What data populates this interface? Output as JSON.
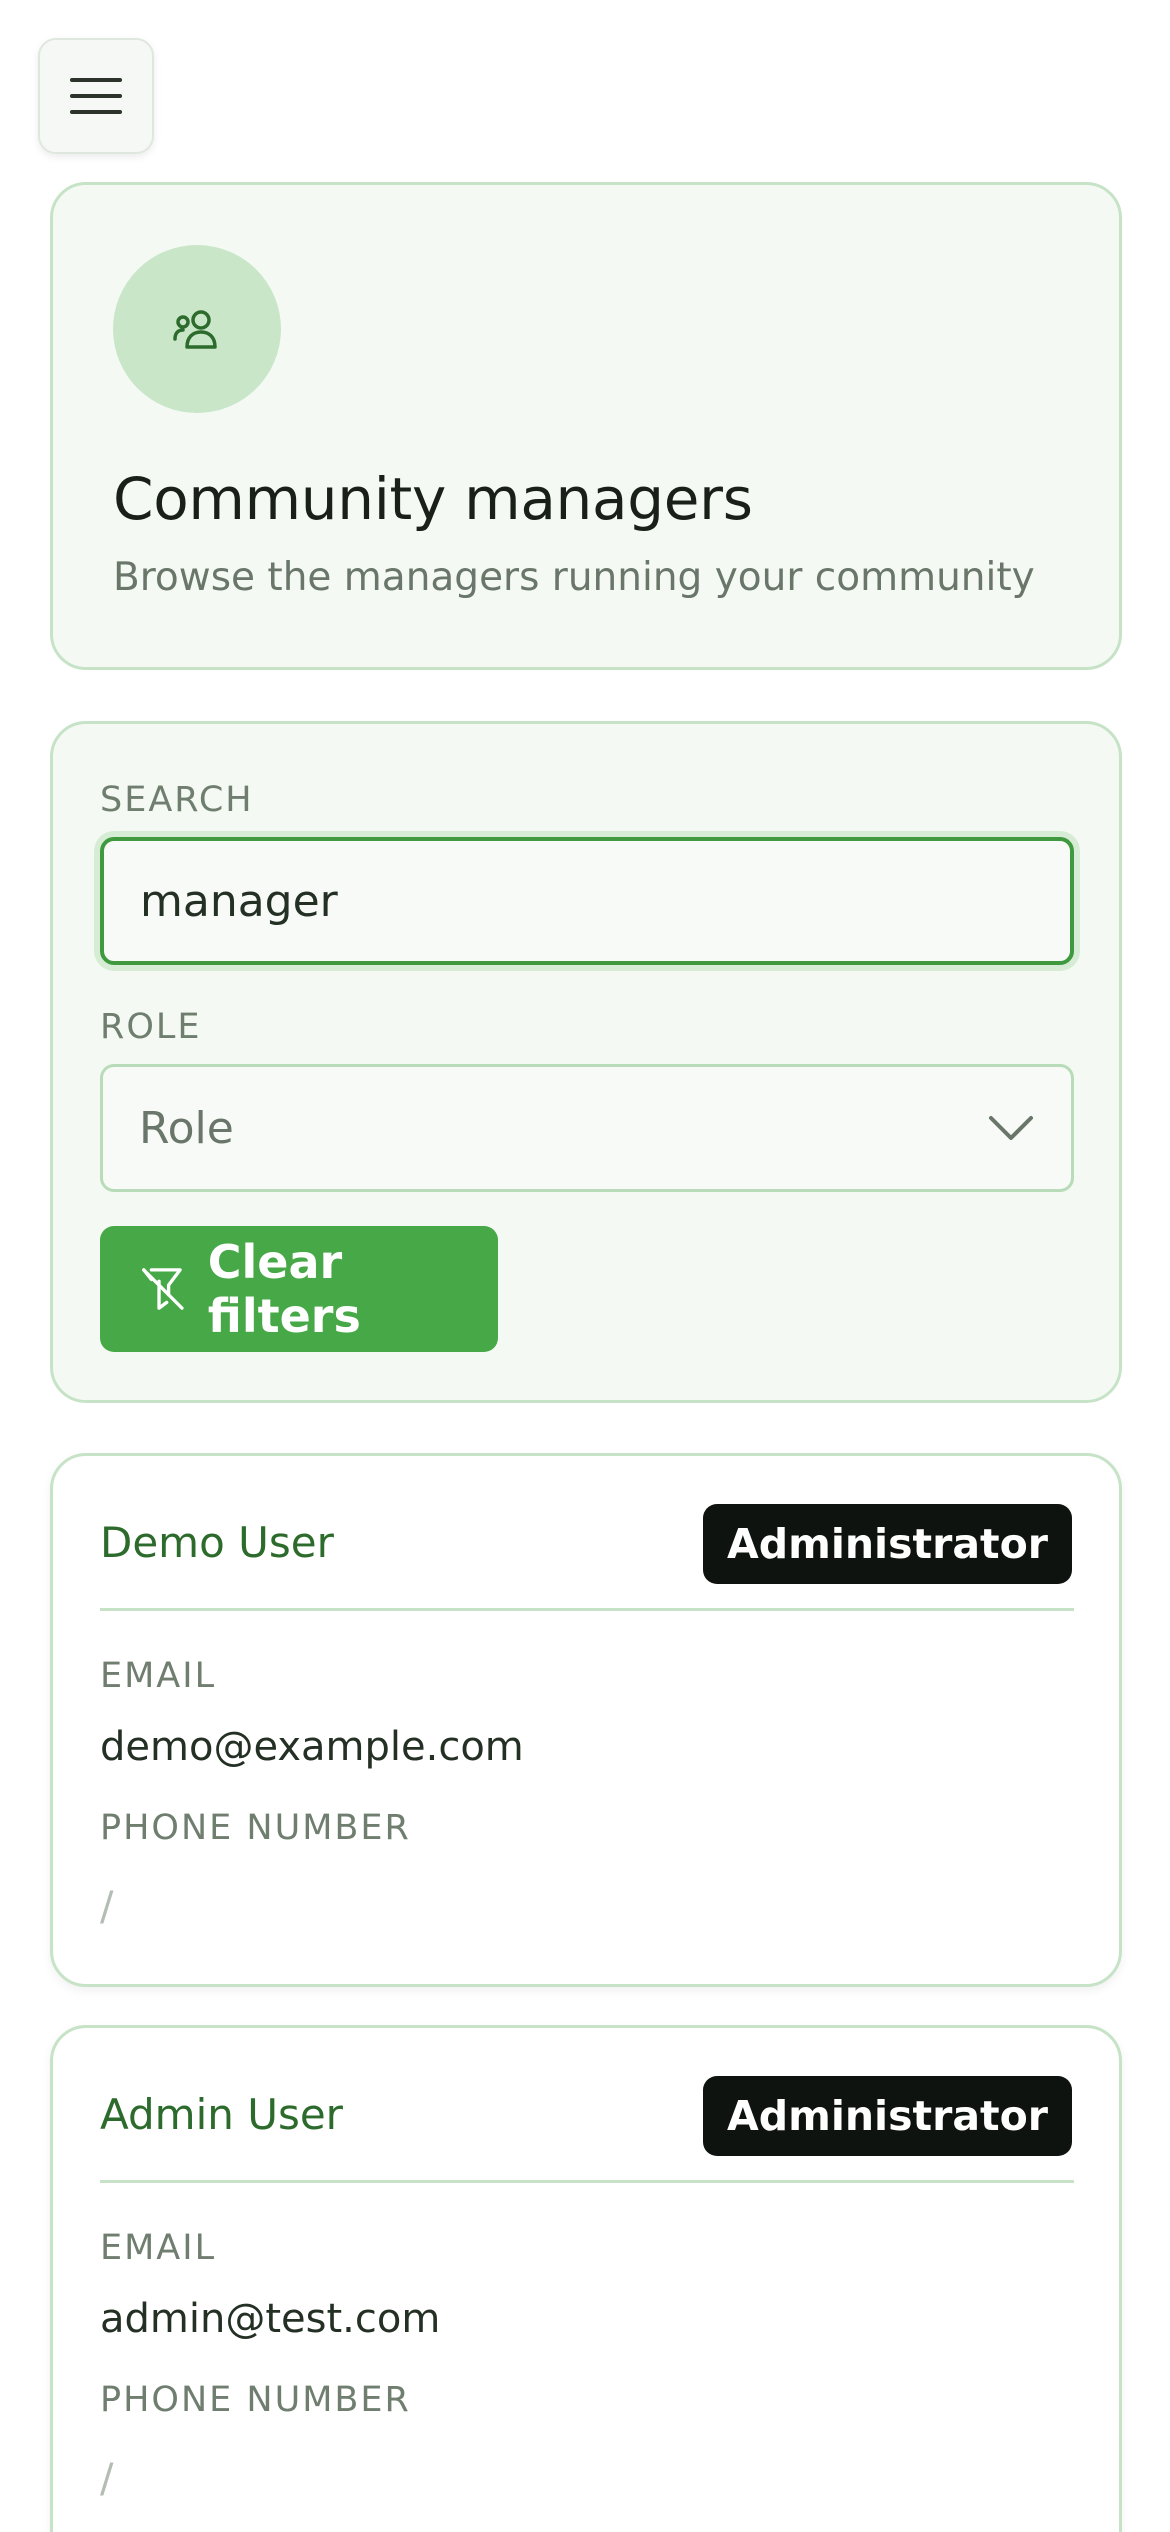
{
  "icons": {
    "menu": "menu-icon",
    "community": "users-icon",
    "chevron": "chevron-down-icon",
    "filter_off": "filter-off-icon"
  },
  "header": {
    "title": "Community managers",
    "subtitle": "Browse the managers running your community"
  },
  "filters": {
    "search_label": "SEARCH",
    "search_value": "manager",
    "role_label": "ROLE",
    "role_value": "Role",
    "clear_label": "Clear filters"
  },
  "users": [
    {
      "name": "Demo User",
      "role": "Administrator",
      "email_label": "EMAIL",
      "email": "demo@example.com",
      "phone_label": "PHONE NUMBER",
      "phone": "/"
    },
    {
      "name": "Admin User",
      "role": "Administrator",
      "email_label": "EMAIL",
      "email": "admin@test.com",
      "phone_label": "PHONE NUMBER",
      "phone": "/"
    }
  ],
  "colors": {
    "accent": "#46a846",
    "card_border": "#c7e3c7",
    "card_bg": "#f4faf3",
    "name_text": "#2c6b2c",
    "badge_bg": "#0f130f"
  }
}
